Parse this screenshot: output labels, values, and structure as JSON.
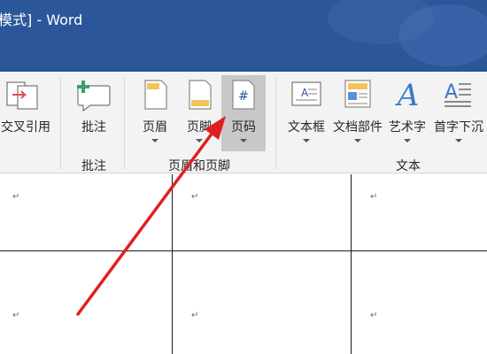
{
  "window": {
    "title": "模式] - Word"
  },
  "ribbon": {
    "buttons": [
      {
        "label": "交叉引用",
        "icon": "cross-reference-icon",
        "has_dropdown": false
      },
      {
        "label": "批注",
        "icon": "comment-add-icon",
        "has_dropdown": false
      },
      {
        "label": "页眉",
        "icon": "header-icon",
        "has_dropdown": true
      },
      {
        "label": "页脚",
        "icon": "footer-icon",
        "has_dropdown": true
      },
      {
        "label": "页码",
        "icon": "page-number-icon",
        "has_dropdown": true,
        "highlighted": true
      },
      {
        "label": "文本框",
        "icon": "text-box-icon",
        "has_dropdown": true
      },
      {
        "label": "文档部件",
        "icon": "quick-parts-icon",
        "has_dropdown": true
      },
      {
        "label": "艺术字",
        "icon": "wordart-icon",
        "has_dropdown": true
      },
      {
        "label": "首字下沉",
        "icon": "drop-cap-icon",
        "has_dropdown": true
      }
    ],
    "groups": {
      "comments": "批注",
      "header_footer": "页眉和页脚",
      "text": "文本"
    }
  },
  "document": {
    "paragraph_mark": "↵"
  },
  "colors": {
    "titlebar": "#2b579a",
    "ribbon": "#f3f3f3",
    "highlight": "#c8c8c8",
    "arrow": "#e02020"
  }
}
